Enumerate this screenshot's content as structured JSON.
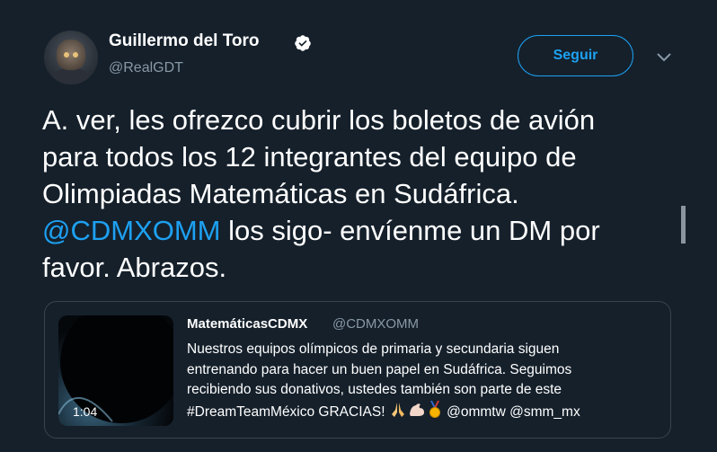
{
  "author": {
    "name": "Guillermo del Toro",
    "handle": "@RealGDT",
    "verified": true
  },
  "actions": {
    "follow_label": "Seguir",
    "menu_icon": "chevron-down-icon"
  },
  "tweet": {
    "lines": [
      "A. ver, les ofrezco cubrir los boletos de avión",
      "para todos los 12 integrantes del equipo de",
      "Olimpiadas Matemáticas en Sudáfrica."
    ],
    "mention": "@CDMXOMM",
    "line4_rest": " los sigo-  envíenme un DM por",
    "line5": "favor. Abrazos."
  },
  "quoted": {
    "name": "MatemáticasCDMX",
    "handle": "@CDMXOMM",
    "video_duration": "1:04",
    "lines": [
      "Nuestros equipos olímpicos de primaria y secundaria siguen",
      "entrenando para hacer un buen papel en Sudáfrica. Seguimos",
      "recibiendo sus donativos, ustedes también son parte de este"
    ],
    "last_line_text": "#DreamTeamMéxico GRACIAS! ",
    "last_line_tail": "@ommtw @smm_mx",
    "emojis": [
      "folded-hands",
      "flexed-biceps",
      "medal"
    ]
  },
  "colors": {
    "background": "#15202b",
    "accent": "#1da1f2",
    "secondary_text": "#8899a6",
    "border": "#38444d"
  }
}
